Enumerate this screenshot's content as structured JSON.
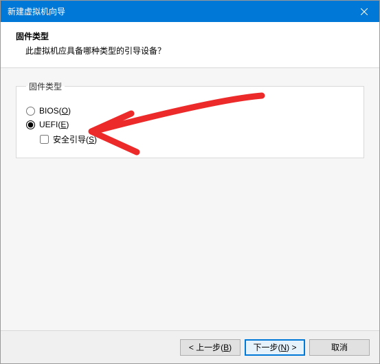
{
  "titlebar": {
    "title": "新建虚拟机向导"
  },
  "header": {
    "title": "固件类型",
    "subtitle": "此虚拟机应具备哪种类型的引导设备？"
  },
  "firmware": {
    "legend": "固件类型",
    "options": {
      "bios_prefix": "BIOS(",
      "bios_hotkey": "O",
      "bios_suffix": ")",
      "uefi_prefix": "UEFI(",
      "uefi_hotkey": "E",
      "uefi_suffix": ")",
      "secure_prefix": "安全引导(",
      "secure_hotkey": "S",
      "secure_suffix": ")"
    }
  },
  "footer": {
    "back_prefix": "< 上一步(",
    "back_hotkey": "B",
    "back_suffix": ")",
    "next_prefix": "下一步(",
    "next_hotkey": "N",
    "next_suffix": ") >",
    "cancel": "取消"
  },
  "annotation": {
    "color": "#ed2a2a"
  }
}
